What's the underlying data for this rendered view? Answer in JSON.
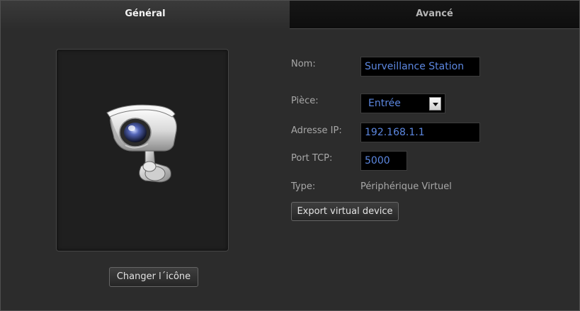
{
  "tabs": {
    "general": "Général",
    "advanced": "Avancé"
  },
  "icon_panel": {
    "icon": "security-camera-icon",
    "change_button": "Changer l´icône"
  },
  "form": {
    "name_label": "Nom:",
    "name_value": "Surveillance Station",
    "room_label": "Pièce:",
    "room_value": "Entrée",
    "ip_label": "Adresse IP:",
    "ip_value": "192.168.1.1",
    "port_label": "Port TCP:",
    "port_value": "5000",
    "type_label": "Type:",
    "type_value": "Périphérique Virtuel",
    "export_button": "Export virtual device"
  },
  "colors": {
    "background": "#2c2c2c",
    "field_background": "#000000",
    "field_text": "#5c87e0",
    "label_text": "#a8a8a8"
  }
}
